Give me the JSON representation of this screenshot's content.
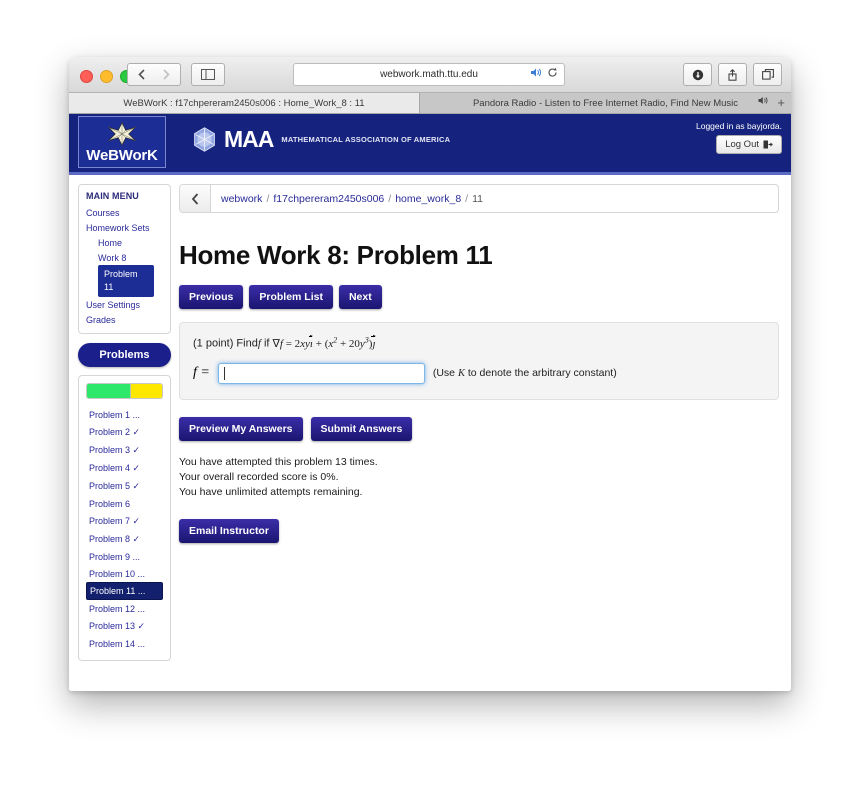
{
  "browser": {
    "url": "webwork.math.ttu.edu",
    "nav": {
      "back_icon": "chevron-left-icon",
      "forward_icon": "chevron-right-icon",
      "sidebar_icon": "sidebar-toggle-icon"
    },
    "url_icons": {
      "audio": "speaker-icon",
      "reload": "reload-icon"
    },
    "toolbar_icons": {
      "download": "download-icon",
      "share": "share-icon",
      "tabs": "tab-overview-icon"
    },
    "tabs": [
      {
        "title": "WeBWorK : f17chpereram2450s006 : Home_Work_8 : 11",
        "active": true
      },
      {
        "title": "Pandora Radio - Listen to Free Internet Radio, Find New Music",
        "active": false,
        "audio_icon": "speaker-icon"
      }
    ],
    "new_tab_label": "+"
  },
  "header": {
    "brand": "WeBWorK",
    "maa_title": "MAA",
    "maa_subtitle": "MATHEMATICAL ASSOCIATION OF AMERICA",
    "login_text": "Logged in as bayjorda.",
    "logout_label": "Log Out",
    "logout_icon": "logout-icon",
    "bg_color": "#16237e",
    "accent_border": "#5b6bc4"
  },
  "breadcrumb": {
    "back_icon": "chevron-left-icon",
    "items": [
      {
        "label": "webwork",
        "link": true
      },
      {
        "label": "f17chpereram2450s006",
        "link": true
      },
      {
        "label": "home_work_8",
        "link": true
      },
      {
        "label": "11",
        "link": false
      }
    ],
    "separator": "/"
  },
  "sidebar": {
    "menu_title": "MAIN MENU",
    "items": [
      {
        "label": "Courses",
        "level": 0,
        "current": false
      },
      {
        "label": "Homework Sets",
        "level": 0,
        "current": false
      },
      {
        "label": "Home",
        "level": 1,
        "current": false
      },
      {
        "label": "Work 8",
        "level": 1,
        "current": false
      },
      {
        "label": "Problem 11",
        "level": 1,
        "current": true
      },
      {
        "label": "User Settings",
        "level": 0,
        "current": false
      },
      {
        "label": "Grades",
        "level": 0,
        "current": false
      }
    ],
    "problems_button": "Problems",
    "progress": {
      "green_pct": 58,
      "yellow_pct": 42,
      "green_color": "#2ee86b",
      "yellow_color": "#ffe800"
    },
    "problem_list": [
      {
        "label": "Problem 1 ...",
        "current": false
      },
      {
        "label": "Problem 2 ✓",
        "current": false
      },
      {
        "label": "Problem 3 ✓",
        "current": false
      },
      {
        "label": "Problem 4 ✓",
        "current": false
      },
      {
        "label": "Problem 5 ✓",
        "current": false
      },
      {
        "label": "Problem 6",
        "current": false
      },
      {
        "label": "Problem 7 ✓",
        "current": false
      },
      {
        "label": "Problem 8 ✓",
        "current": false
      },
      {
        "label": "Problem 9 ...",
        "current": false
      },
      {
        "label": "Problem 10 ...",
        "current": false
      },
      {
        "label": "Problem 11 ...",
        "current": true
      },
      {
        "label": "Problem 12 ...",
        "current": false
      },
      {
        "label": "Problem 13 ✓",
        "current": false
      },
      {
        "label": "Problem 14 ...",
        "current": false
      }
    ]
  },
  "main": {
    "title": "Home Work 8: Problem 11",
    "nav_buttons": [
      {
        "label": "Previous"
      },
      {
        "label": "Problem List"
      },
      {
        "label": "Next"
      }
    ],
    "problem": {
      "points": "(1 point)",
      "prompt": "Find",
      "prompt_var": "f",
      "prompt_if": "if",
      "equation_plain": "∇f = 2xy i⃗ + (x² + 20y³) j⃗",
      "answer_label": "f =",
      "answer_value": "",
      "answer_placeholder": "",
      "hint": "(Use K to denote the arbitrary constant)"
    },
    "action_buttons": [
      {
        "label": "Preview My Answers"
      },
      {
        "label": "Submit Answers"
      }
    ],
    "status_lines": [
      "You have attempted this problem 13 times.",
      "Your overall recorded score is 0%.",
      "You have unlimited attempts remaining."
    ],
    "email_button": "Email Instructor"
  }
}
